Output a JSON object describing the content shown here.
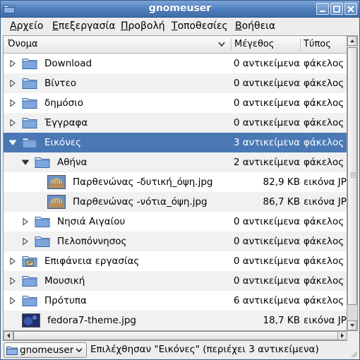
{
  "window": {
    "title": "gnomeuser"
  },
  "menu": [
    {
      "mnemonic": "Α",
      "rest": "ρχείο"
    },
    {
      "mnemonic": "Ε",
      "rest": "πεξεργασία"
    },
    {
      "mnemonic": "Π",
      "rest": "ροβολή"
    },
    {
      "mnemonic": "Τ",
      "rest": "οποθεσίες"
    },
    {
      "mnemonic": "Β",
      "rest": "οήθεια"
    }
  ],
  "columns": {
    "name": "Όνομα",
    "size": "Μέγεθος",
    "type": "Τύπος"
  },
  "rows": [
    {
      "name": "Download",
      "size": "0 αντικείμενα",
      "type": "φάκελος",
      "icon": "folder-icon"
    },
    {
      "name": "Βίντεο",
      "size": "0 αντικείμενα",
      "type": "φάκελος",
      "icon": "folder-icon"
    },
    {
      "name": "δημόσιο",
      "size": "0 αντικείμενα",
      "type": "φάκελος",
      "icon": "folder-icon"
    },
    {
      "name": "Έγγραφα",
      "size": "0 αντικείμενα",
      "type": "φάκελος",
      "icon": "folder-icon"
    },
    {
      "name": "Εικόνες",
      "size": "3 αντικείμενα",
      "type": "φάκελος",
      "icon": "folder-icon",
      "expanded": true,
      "selected": true
    },
    {
      "name": "Αθήνα",
      "size": "2 αντικείμενα",
      "type": "φάκελος",
      "icon": "folder-icon",
      "expanded": true
    },
    {
      "name": "Παρθενώνας -δυτική_όψη.jpg",
      "size": "82,9 KB",
      "type": "εικόνα JPEG",
      "icon": "image-thumbnail-icon"
    },
    {
      "name": "Παρθενώνας -νότια_όψη.jpg",
      "size": "86,7 KB",
      "type": "εικόνα JPEG",
      "icon": "image-thumbnail-icon"
    },
    {
      "name": "Νησιά Αιγαίου",
      "size": "0 αντικείμενα",
      "type": "φάκελος",
      "icon": "folder-icon"
    },
    {
      "name": "Πελοπόννησος",
      "size": "0 αντικείμενα",
      "type": "φάκελος",
      "icon": "folder-icon"
    },
    {
      "name": "Επιφάνεια εργασίας",
      "size": "0 αντικείμενα",
      "type": "φάκελος",
      "icon": "desktop-folder-icon"
    },
    {
      "name": "Μουσική",
      "size": "0 αντικείμενα",
      "type": "φάκελος",
      "icon": "folder-icon"
    },
    {
      "name": "Πρότυπα",
      "size": "6 αντικείμενα",
      "type": "φάκελος",
      "icon": "folder-icon"
    },
    {
      "name": "fedora7-theme.jpg",
      "size": "18,7 KB",
      "type": "εικόνα JPEG",
      "icon": "image-thumbnail-icon"
    }
  ],
  "status": {
    "location": "gnomeuser",
    "text": "Επιλέχθησαν \"Εικόνες\" (περιέχει 3 αντικείμενα)"
  },
  "colors": {
    "selection": "#4a78b5",
    "titlebar": "#4f7ebd",
    "folder": "#6e9ad4"
  }
}
